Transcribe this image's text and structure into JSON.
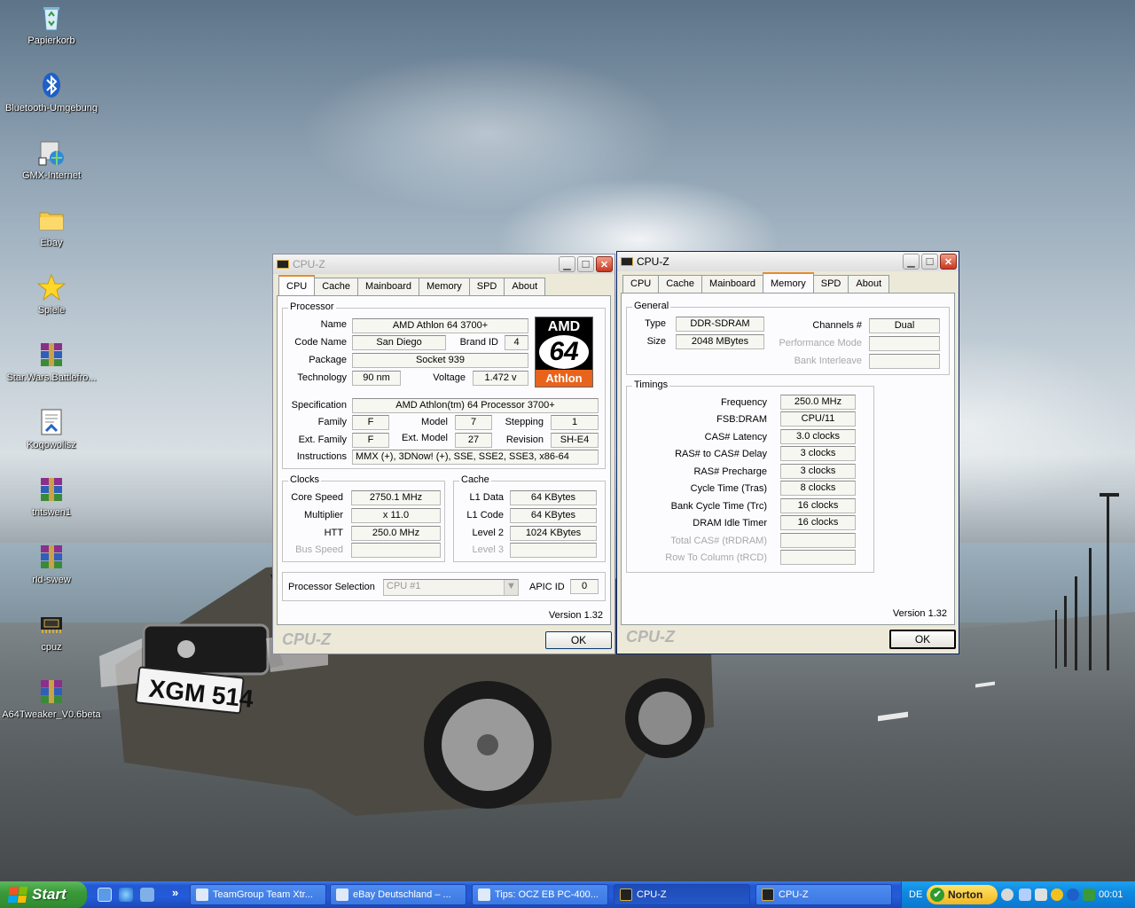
{
  "desktop": {
    "icons": [
      {
        "label": "Papierkorb",
        "icon": "recycle-bin-icon"
      },
      {
        "label": "Bluetooth-Umgebung",
        "icon": "bluetooth-icon"
      },
      {
        "label": "GMX-Internet",
        "icon": "internet-shortcut-icon"
      },
      {
        "label": "Ebay",
        "icon": "folder-icon"
      },
      {
        "label": "Spiele",
        "icon": "star-icon"
      },
      {
        "label": "Star.Wars.Battlefro...",
        "icon": "winrar-archive-icon"
      },
      {
        "label": "Kogowolisz",
        "icon": "document-icon"
      },
      {
        "label": "tntswen1",
        "icon": "winrar-archive-icon"
      },
      {
        "label": "rld-swew",
        "icon": "winrar-archive-icon"
      },
      {
        "label": "cpuz",
        "icon": "cpu-chip-icon"
      },
      {
        "label": "A64Tweaker_V0.6beta",
        "icon": "winrar-archive-icon"
      }
    ],
    "wallpaper_plate": "XGM 514"
  },
  "win1": {
    "title": "CPU-Z",
    "tabs": [
      "CPU",
      "Cache",
      "Mainboard",
      "Memory",
      "SPD",
      "About"
    ],
    "selected_tab": "CPU",
    "processor": {
      "group": "Processor",
      "name_label": "Name",
      "name": "AMD Athlon 64 3700+",
      "codename_label": "Code Name",
      "codename": "San Diego",
      "brandid_label": "Brand ID",
      "brandid": "4",
      "package_label": "Package",
      "package": "Socket 939",
      "technology_label": "Technology",
      "technology": "90 nm",
      "voltage_label": "Voltage",
      "voltage": "1.472 v",
      "spec_label": "Specification",
      "spec": "AMD Athlon(tm) 64 Processor 3700+",
      "family_label": "Family",
      "family": "F",
      "model_label": "Model",
      "model": "7",
      "stepping_label": "Stepping",
      "stepping": "1",
      "extfamily_label": "Ext. Family",
      "extfamily": "F",
      "extmodel_label": "Ext. Model",
      "extmodel": "27",
      "revision_label": "Revision",
      "revision": "SH-E4",
      "instructions_label": "Instructions",
      "instructions": "MMX (+), 3DNow! (+), SSE, SSE2, SSE3, x86-64"
    },
    "logo": {
      "line1": "AMD",
      "line2": "64",
      "line3": "Athlon"
    },
    "clocks": {
      "group": "Clocks",
      "core_label": "Core Speed",
      "core": "2750.1 MHz",
      "mult_label": "Multiplier",
      "mult": "x 11.0",
      "htt_label": "HTT",
      "htt": "250.0 MHz",
      "bus_label": "Bus Speed",
      "bus": ""
    },
    "cache": {
      "group": "Cache",
      "l1d_label": "L1 Data",
      "l1d": "64 KBytes",
      "l1c_label": "L1 Code",
      "l1c": "64 KBytes",
      "l2_label": "Level 2",
      "l2": "1024 KBytes",
      "l3_label": "Level 3",
      "l3": ""
    },
    "selection": {
      "label": "Processor Selection",
      "value": "CPU #1",
      "apic_label": "APIC ID",
      "apic": "0"
    },
    "version": "Version 1.32",
    "brand": "CPU-Z",
    "ok": "OK"
  },
  "win2": {
    "title": "CPU-Z",
    "tabs": [
      "CPU",
      "Cache",
      "Mainboard",
      "Memory",
      "SPD",
      "About"
    ],
    "selected_tab": "Memory",
    "general": {
      "group": "General",
      "type_label": "Type",
      "type": "DDR-SDRAM",
      "size_label": "Size",
      "size": "2048 MBytes",
      "channels_label": "Channels #",
      "channels": "Dual",
      "perf_label": "Performance Mode",
      "perf": "",
      "bank_label": "Bank Interleave",
      "bank": ""
    },
    "timings": {
      "group": "Timings",
      "rows": [
        {
          "label": "Frequency",
          "value": "250.0 MHz",
          "disabled": false
        },
        {
          "label": "FSB:DRAM",
          "value": "CPU/11",
          "disabled": false
        },
        {
          "label": "CAS# Latency",
          "value": "3.0 clocks",
          "disabled": false
        },
        {
          "label": "RAS# to CAS# Delay",
          "value": "3 clocks",
          "disabled": false
        },
        {
          "label": "RAS# Precharge",
          "value": "3 clocks",
          "disabled": false
        },
        {
          "label": "Cycle Time (Tras)",
          "value": "8 clocks",
          "disabled": false
        },
        {
          "label": "Bank Cycle Time (Trc)",
          "value": "16 clocks",
          "disabled": false
        },
        {
          "label": "DRAM Idle Timer",
          "value": "16 clocks",
          "disabled": false
        },
        {
          "label": "Total CAS# (tRDRAM)",
          "value": "",
          "disabled": true
        },
        {
          "label": "Row To Column (tRCD)",
          "value": "",
          "disabled": true
        }
      ]
    },
    "version": "Version 1.32",
    "brand": "CPU-Z",
    "ok": "OK"
  },
  "taskbar": {
    "start": "Start",
    "quicklaunch_more": "»",
    "tasks": [
      {
        "label": "TeamGroup Team Xtr...",
        "pressed": false
      },
      {
        "label": "eBay Deutschland – ...",
        "pressed": false
      },
      {
        "label": "Tips: OCZ EB PC-400...",
        "pressed": false
      },
      {
        "label": "CPU-Z",
        "pressed": true
      },
      {
        "label": "CPU-Z",
        "pressed": false
      }
    ],
    "language": "DE",
    "norton": "Norton",
    "clock": "00:01"
  }
}
